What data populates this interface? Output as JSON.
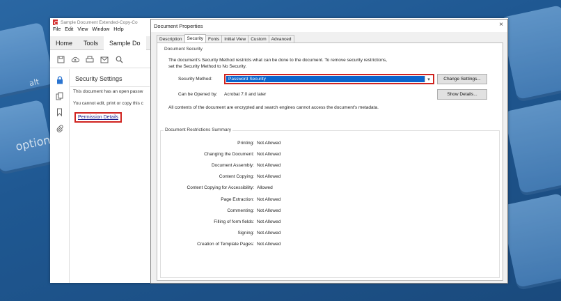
{
  "background": {
    "key_label_1": "alt",
    "key_label_2": "option"
  },
  "acrobat": {
    "window_title": "Sample Document Extended-Copy-Co",
    "menu": [
      "File",
      "Edit",
      "View",
      "Window",
      "Help"
    ],
    "tabs": [
      "Home",
      "Tools",
      "Sample Do"
    ],
    "panel": {
      "title": "Security Settings",
      "text1": "This document has an open passw",
      "text2": "You cannot edit, print or copy this c",
      "link": "Permission Details"
    }
  },
  "dialog": {
    "title": "Document Properties",
    "close": "×",
    "tabs": [
      "Description",
      "Security",
      "Fonts",
      "Initial View",
      "Custom",
      "Advanced"
    ],
    "active_tab": "Security",
    "doc_security": {
      "group_label": "Document Security",
      "description": "The document's Security Method restricts what can be done to the document. To remove security restrictions, set the Security Method to No Security.",
      "method_label": "Security Method:",
      "method_value": "Password Security",
      "change_settings": "Change Settings...",
      "opened_label": "Can be Opened by:",
      "opened_value": "Acrobat 7.0 and later",
      "show_details": "Show Details...",
      "encrypt_note": "All contents of the document are encrypted and search engines cannot access the document's metadata."
    },
    "restrictions": {
      "group_label": "Document Restrictions Summary",
      "rows": [
        {
          "label": "Printing:",
          "value": "Not Allowed"
        },
        {
          "label": "Changing the Document:",
          "value": "Not Allowed"
        },
        {
          "label": "Document Assembly:",
          "value": "Not Allowed"
        },
        {
          "label": "Content Copying:",
          "value": "Not Allowed"
        },
        {
          "label": "Content Copying for Accessibility:",
          "value": "Allowed"
        },
        {
          "label": "Page Extraction:",
          "value": "Not Allowed"
        },
        {
          "label": "Commenting:",
          "value": "Not Allowed"
        },
        {
          "label": "Filling of form fields:",
          "value": "Not Allowed"
        },
        {
          "label": "Signing:",
          "value": "Not Allowed"
        },
        {
          "label": "Creation of Template Pages:",
          "value": "Not Allowed"
        }
      ]
    }
  },
  "colors": {
    "highlight_red": "#d0231f",
    "select_blue": "#0a64cc",
    "desktop_blue": "#1f5892"
  }
}
